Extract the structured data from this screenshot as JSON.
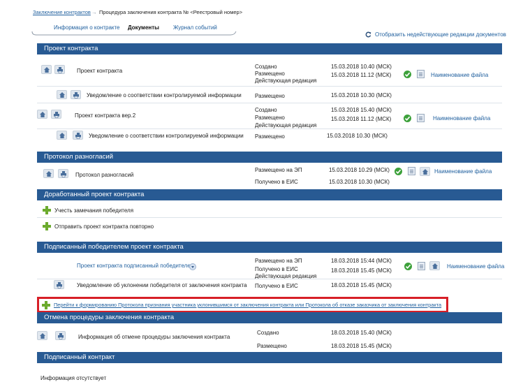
{
  "breadcrumb": {
    "root": "Заключение контрактов",
    "separator": "→",
    "current": "Процедура заключения контракта № <Реестровый номер>"
  },
  "tabs": [
    {
      "label": "Информация о контракте",
      "active": false
    },
    {
      "label": "Документы",
      "active": true
    },
    {
      "label": "Журнал событий",
      "active": false
    }
  ],
  "show_inactive_link": "Отобразить недействующие редакции документов",
  "file_link": "Наименование файла",
  "sections": {
    "project": {
      "title": "Проект контракта",
      "rows": [
        {
          "name": "Проект контракта",
          "statuses": [
            "Создано",
            "Размещено",
            "Действующая редакция"
          ],
          "dates": [
            "15.03.2018 10.40 (МСК)",
            "15.03.2018 11.12 (МСК)"
          ]
        },
        {
          "name": "Уведомление о соответствии контролируемой информации",
          "statuses": [
            "Размещено"
          ],
          "dates": [
            "15.03.2018 10.30 (МСК)"
          ]
        },
        {
          "name": "Проект контракта вер.2",
          "statuses": [
            "Создано",
            "Размещено",
            "Действующая редакция"
          ],
          "dates": [
            "15.03.2018 15.40 (МСК)",
            "15.03.2018 11.12 (МСК)"
          ]
        },
        {
          "name": "Уведомление о соответствии контролируемой информации",
          "statuses": [
            "Размещено"
          ],
          "dates": [
            "15.03.2018 10.30 (МСК)"
          ]
        }
      ]
    },
    "protocol": {
      "title": "Протокол разногласий",
      "rows": [
        {
          "name": "Протокол разногласий",
          "statuses": [
            "Размещено на ЭП",
            "Получено в ЕИС"
          ],
          "dates": [
            "15.03.2018 10.29 (МСК)",
            "15.03.2018 10.30 (МСК)"
          ]
        }
      ]
    },
    "revised": {
      "title": "Доработанный проект контракта",
      "actions": [
        "Учесть замечания победителя",
        "Отправить проект контракта повторно"
      ]
    },
    "signed_winner": {
      "title": "Подписанный победителем проект контракта",
      "rows": [
        {
          "name": "Проект контракта подписанный победителем",
          "statuses": [
            "Размещено на ЭП",
            "Получено в ЕИС",
            "Действующая редакция"
          ],
          "dates": [
            "18.03.2018 15:44 (МСК)",
            "18.03.2018 15.45 (МСК)"
          ]
        },
        {
          "name": "Уведомление об уклонении победителя от заключения контракта",
          "statuses": [
            "Получено в ЕИС"
          ],
          "dates": [
            "18.03.2018 15.45 (МСК)"
          ]
        }
      ],
      "highlight_link": "Перейти к формированию Протокола признания участника уклонившимся от заключения контракта или Протокола об отказе заказчика от заключения контракта"
    },
    "cancel": {
      "title": "Отмена процедуры заключения контракта",
      "rows": [
        {
          "name": "Информация об отмене процедуры заключения контракта",
          "statuses": [
            "Создано",
            "Размещено"
          ],
          "dates": [
            "18.03.2018 15.40 (МСК)",
            "18.03.2018 15.45 (МСК)"
          ]
        }
      ]
    },
    "signed": {
      "title": "Подписанный контракт",
      "empty_text": "Информация отсутствует"
    }
  },
  "colors": {
    "section_bar": "#285a93",
    "link": "#1f5f9e",
    "highlight_border": "#d71f27",
    "check": "#3da13b",
    "plus": "#6cab2e"
  }
}
